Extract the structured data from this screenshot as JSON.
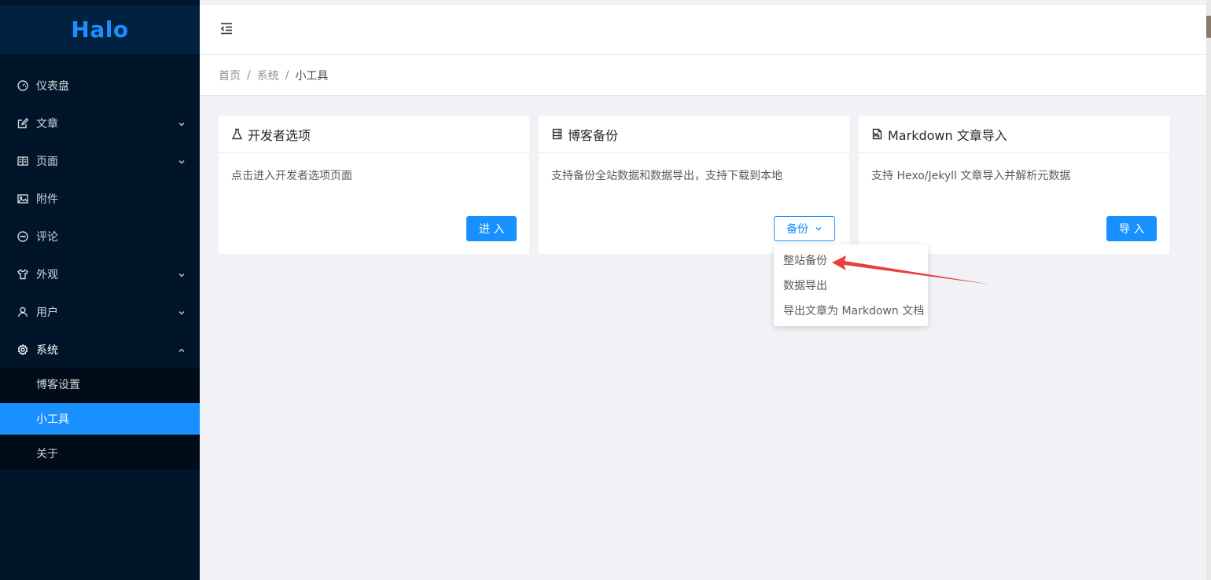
{
  "logo": {
    "text": "Halo"
  },
  "sidebar": {
    "items": [
      {
        "label": "仪表盘",
        "icon": "dashboard-icon",
        "has_arrow": false
      },
      {
        "label": "文章",
        "icon": "form-icon",
        "has_arrow": true
      },
      {
        "label": "页面",
        "icon": "read-icon",
        "has_arrow": true
      },
      {
        "label": "附件",
        "icon": "picture-icon",
        "has_arrow": false
      },
      {
        "label": "评论",
        "icon": "message-icon",
        "has_arrow": false
      },
      {
        "label": "外观",
        "icon": "skin-icon",
        "has_arrow": true
      },
      {
        "label": "用户",
        "icon": "user-icon",
        "has_arrow": true
      },
      {
        "label": "系统",
        "icon": "setting-icon",
        "has_arrow": true,
        "open": true
      }
    ],
    "system_submenu": [
      {
        "label": "博客设置"
      },
      {
        "label": "小工具",
        "active": true
      },
      {
        "label": "关于"
      }
    ]
  },
  "breadcrumb": {
    "items": [
      "首页",
      "系统",
      "小工具"
    ],
    "separator": "/"
  },
  "cards": [
    {
      "title": "开发者选项",
      "icon": "experiment-icon",
      "description": "点击进入开发者选项页面",
      "button_label": "进 入"
    },
    {
      "title": "博客备份",
      "icon": "hdd-icon",
      "description": "支持备份全站数据和数据导出，支持下载到本地",
      "button_label": "备份"
    },
    {
      "title": "Markdown 文章导入",
      "icon": "file-markdown-icon",
      "description": "支持 Hexo/Jekyll 文章导入并解析元数据",
      "button_label": "导 入"
    }
  ],
  "backup_dropdown": {
    "items": [
      "整站备份",
      "数据导出",
      "导出文章为 Markdown 文档"
    ]
  },
  "colors": {
    "primary": "#1890ff",
    "sider_bg": "#001529",
    "annotation_arrow": "#e8403a"
  }
}
